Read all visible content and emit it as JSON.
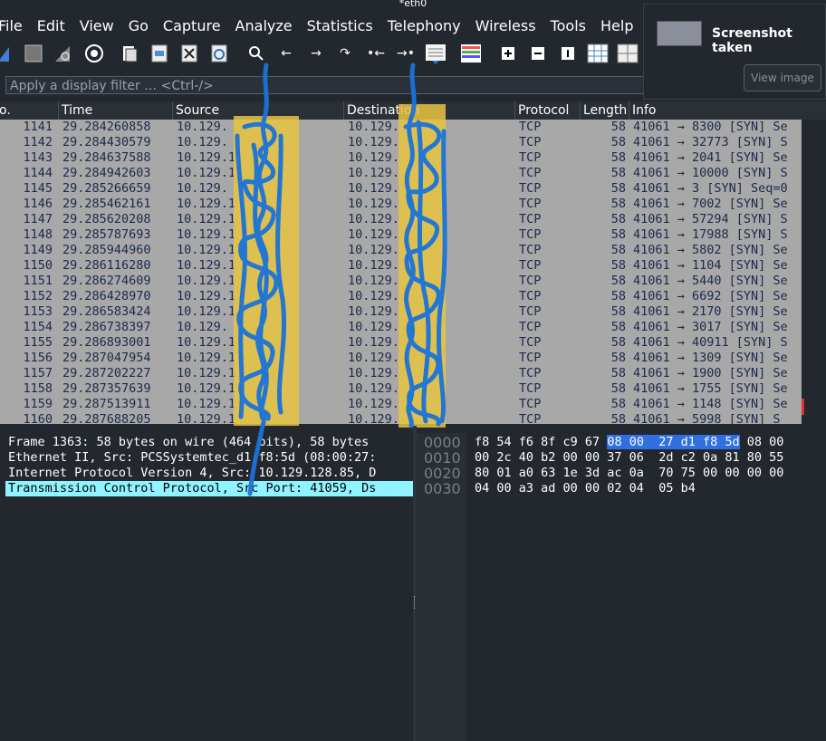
{
  "window": {
    "title": "*eth0"
  },
  "menu": [
    "File",
    "Edit",
    "View",
    "Go",
    "Capture",
    "Analyze",
    "Statistics",
    "Telephony",
    "Wireless",
    "Tools",
    "Help"
  ],
  "toolbar": {
    "icons": [
      "shark-fin-start-icon",
      "stop-capture-icon",
      "restart-capture-icon",
      "capture-options-icon",
      "open-file-icon",
      "save-file-icon",
      "close-file-icon",
      "reload-file-icon",
      "find-packet-icon",
      "go-back-icon",
      "go-forward-icon",
      "go-to-packet-icon",
      "go-first-icon",
      "go-last-icon",
      "autoscroll-icon",
      "colorize-icon",
      "zoom-in-icon",
      "zoom-out-icon",
      "normal-size-icon",
      "resize-columns-icon",
      "layout-icon"
    ]
  },
  "filter": {
    "placeholder": "Apply a display filter … <Ctrl-/>"
  },
  "columns": {
    "no": "o.",
    "time": "Time",
    "source": "Source",
    "destination": "Destination",
    "protocol": "Protocol",
    "length": "Length",
    "info": "Info"
  },
  "packets": [
    {
      "no": "1141",
      "time": "29.284260858",
      "src": "10.129.",
      "dst": "10.129.",
      "proto": "TCP",
      "len": "58",
      "info": "41061 → 8300 [SYN] Se"
    },
    {
      "no": "1142",
      "time": "29.284430579",
      "src": "10.129.",
      "dst": "10.129.",
      "proto": "TCP",
      "len": "58",
      "info": "41061 → 32773 [SYN] S"
    },
    {
      "no": "1143",
      "time": "29.284637588",
      "src": "10.129.1",
      "dst": "10.129.",
      "proto": "TCP",
      "len": "58",
      "info": "41061 → 2041 [SYN] Se"
    },
    {
      "no": "1144",
      "time": "29.284942603",
      "src": "10.129.1",
      "dst": "10.129.",
      "proto": "TCP",
      "len": "58",
      "info": "41061 → 10000 [SYN] S"
    },
    {
      "no": "1145",
      "time": "29.285266659",
      "src": "10.129.",
      "dst": "10.129.",
      "proto": "TCP",
      "len": "58",
      "info": "41061 → 3 [SYN] Seq=0"
    },
    {
      "no": "1146",
      "time": "29.285462161",
      "src": "10.129.1",
      "dst": "10.129.",
      "proto": "TCP",
      "len": "58",
      "info": "41061 → 7002 [SYN] Se"
    },
    {
      "no": "1147",
      "time": "29.285620208",
      "src": "10.129.1",
      "dst": "10.129.",
      "proto": "TCP",
      "len": "58",
      "info": "41061 → 57294 [SYN] S"
    },
    {
      "no": "1148",
      "time": "29.285787693",
      "src": "10.129.1",
      "dst": "10.129.",
      "proto": "TCP",
      "len": "58",
      "info": "41061 → 17988 [SYN] S"
    },
    {
      "no": "1149",
      "time": "29.285944960",
      "src": "10.129.1",
      "dst": "10.129.",
      "proto": "TCP",
      "len": "58",
      "info": "41061 → 5802 [SYN] Se"
    },
    {
      "no": "1150",
      "time": "29.286116280",
      "src": "10.129.1",
      "dst": "10.129.",
      "proto": "TCP",
      "len": "58",
      "info": "41061 → 1104 [SYN] Se"
    },
    {
      "no": "1151",
      "time": "29.286274609",
      "src": "10.129.1",
      "dst": "10.129.",
      "proto": "TCP",
      "len": "58",
      "info": "41061 → 5440 [SYN] Se"
    },
    {
      "no": "1152",
      "time": "29.286428970",
      "src": "10.129.1",
      "dst": "10.129.",
      "proto": "TCP",
      "len": "58",
      "info": "41061 → 6692 [SYN] Se"
    },
    {
      "no": "1153",
      "time": "29.286583424",
      "src": "10.129.1",
      "dst": "10.129.",
      "proto": "TCP",
      "len": "58",
      "info": "41061 → 2170 [SYN] Se"
    },
    {
      "no": "1154",
      "time": "29.286738397",
      "src": "10.129.",
      "dst": "10.129.",
      "proto": "TCP",
      "len": "58",
      "info": "41061 → 3017 [SYN] Se"
    },
    {
      "no": "1155",
      "time": "29.286893001",
      "src": "10.129.1",
      "dst": "10.129.",
      "proto": "TCP",
      "len": "58",
      "info": "41061 → 40911 [SYN] S"
    },
    {
      "no": "1156",
      "time": "29.287047954",
      "src": "10.129.1",
      "dst": "10.129.",
      "proto": "TCP",
      "len": "58",
      "info": "41061 → 1309 [SYN] Se"
    },
    {
      "no": "1157",
      "time": "29.287202227",
      "src": "10.129.1",
      "dst": "10.129.",
      "proto": "TCP",
      "len": "58",
      "info": "41061 → 1900 [SYN] Se"
    },
    {
      "no": "1158",
      "time": "29.287357639",
      "src": "10.129.1",
      "dst": "10.129.",
      "proto": "TCP",
      "len": "58",
      "info": "41061 → 1755 [SYN] Se"
    },
    {
      "no": "1159",
      "time": "29.287513911",
      "src": "10.129.1",
      "dst": "10.129.",
      "proto": "TCP",
      "len": "58",
      "info": "41061 → 1148 [SYN] Se"
    },
    {
      "no": "1160",
      "time": "29.287688205",
      "src": "10.129.1",
      "dst": "10.129.",
      "proto": "TCP",
      "len": "58",
      "info": "41061 → 5998 [SYN] S"
    }
  ],
  "details": [
    "Frame 1363: 58 bytes on wire (464 bits), 58 bytes",
    "Ethernet II, Src: PCSSystemtec_d1:f8:5d (08:00:27:",
    "Internet Protocol Version 4, Src: 10.129.128.85, D",
    "Transmission Control Protocol, Src Port: 41059, Ds"
  ],
  "bytes": {
    "offsets": [
      "0000",
      "0010",
      "0020",
      "0030"
    ],
    "row0_a": "f8 54 f6 8f c9 67 ",
    "row0_hl": "08 00  27 d1 f8 5d",
    "row0_b": " 08 00",
    "row1": "00 2c 40 b2 00 00 37 06  2d c2 0a 81 80 55",
    "row2": "80 01 a0 63 1e 3d ac 0a  70 75 00 00 00 00",
    "row3": "04 00 a3 ad 00 00 02 04  05 b4"
  },
  "notification": {
    "title": "Screenshot taken",
    "button": "View image"
  },
  "colors": {
    "background": "#23272e",
    "packet_list": "#a8a8a8",
    "selected_detail": "#8ff4ff",
    "bytes_highlight": "#2f6fe0",
    "scribble": "#1a73d9",
    "redaction_yellow": "#e7c441"
  }
}
